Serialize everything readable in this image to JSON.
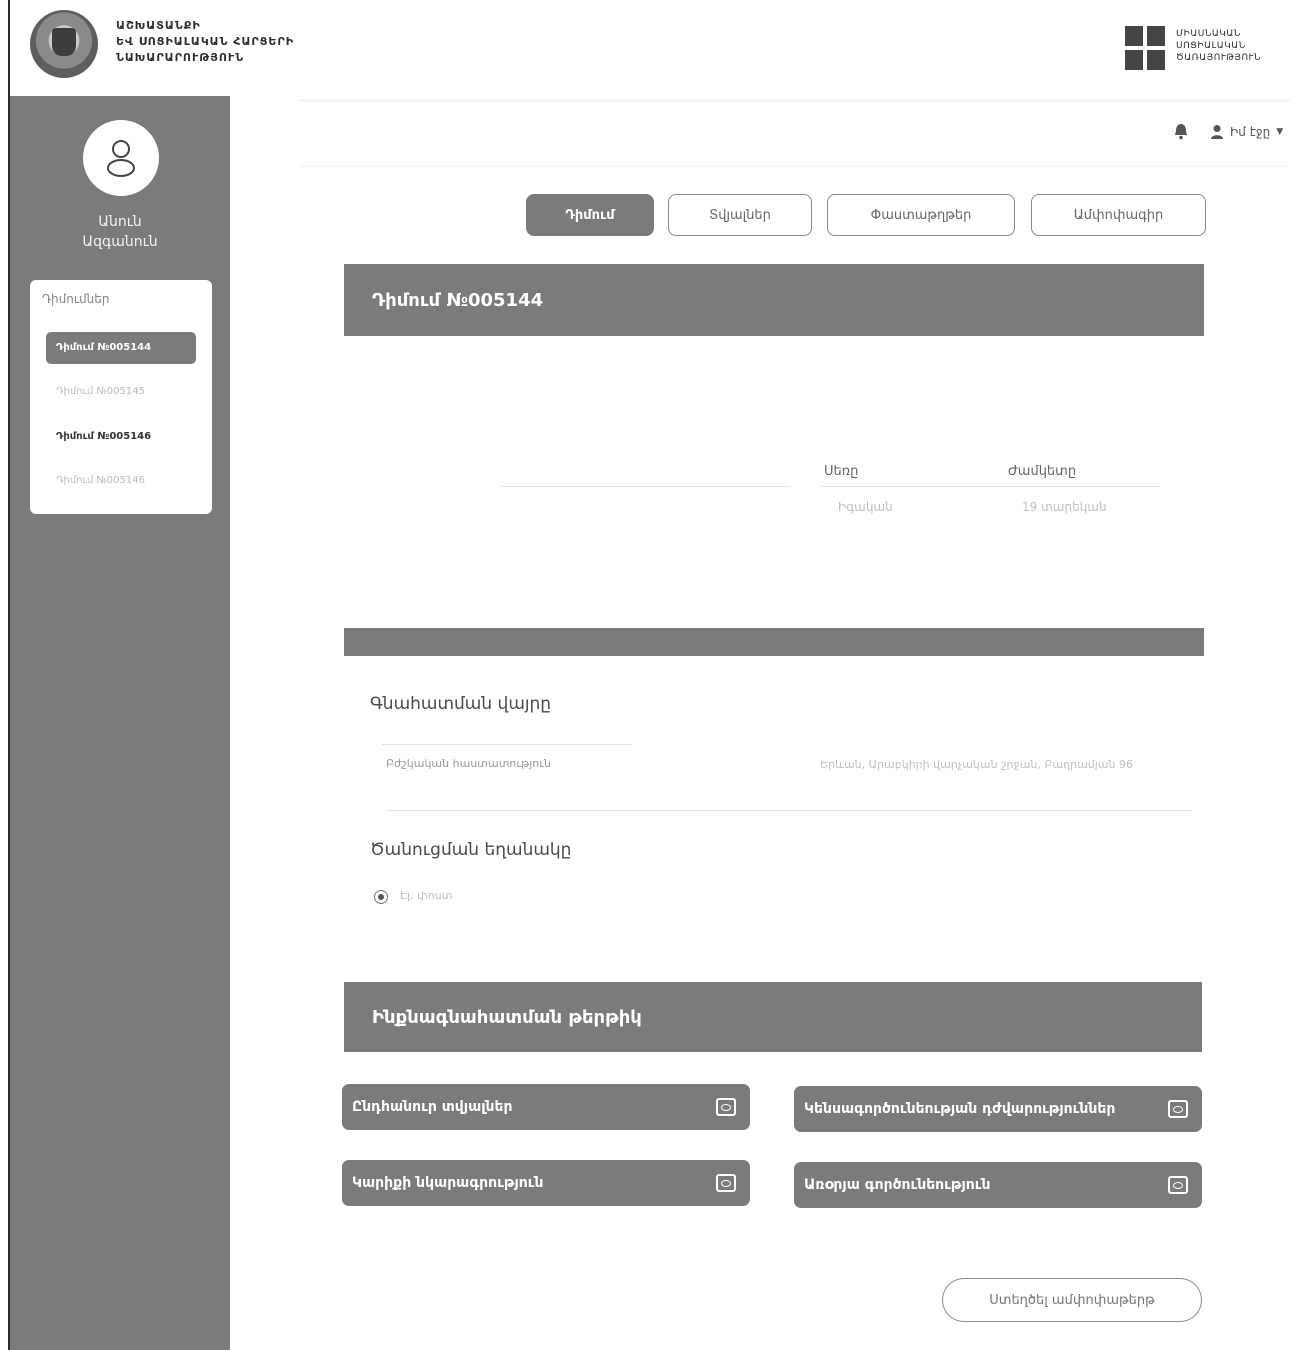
{
  "header": {
    "ministry_lines": [
      "ԱՇԽԱՏԱՆՔԻ",
      "ԵՎ ՍՈՑԻԱԼԱԿԱՆ ՀԱՐՑԵՐԻ",
      "ՆԱԽԱՐԱՐՈՒԹՅՈՒՆ"
    ],
    "agency_lines": [
      "ՄԻԱՍՆԱԿԱՆ",
      "ՍՈՑԻԱԼԱԿԱՆ",
      "ԾԱՌԱՅՈՒԹՅՈՒՆ"
    ]
  },
  "topbar": {
    "user_label": "Իմ էջը"
  },
  "sidebar": {
    "user_first": "Անուն",
    "user_last": "Ազգանուն",
    "applications_title": "Դիմումներ",
    "applications": [
      {
        "label": "Դիմում №005144"
      },
      {
        "label": "Դիմում №005145"
      },
      {
        "label": "Դիմում №005146"
      },
      {
        "label": "Դիմում №005146"
      }
    ]
  },
  "tabs": [
    "Դիմում",
    "Տվյալներ",
    "Փաստաթղթեր",
    "Ամփոփագիր"
  ],
  "application": {
    "title": "Դիմում №005144",
    "col_status": "Սեռը",
    "col_term": "Ժամկետը",
    "status_value": "Իգական",
    "term_value": "19 տարեկան"
  },
  "assessment_place": {
    "title": "Գնահատման վայրը",
    "left_value": "Բժշկական հաստատություն",
    "right_value": "Երևան, Արաբկիրի վարչական շրջան, Բաղրամյան 96"
  },
  "notification": {
    "title": "Ծանուցման եղանակը",
    "option": "Էլ. փոստ"
  },
  "self_assessment": {
    "title": "Ինքնագնահատման թերթիկ",
    "forms": [
      "Ընդհանուր տվյալներ",
      "Կենսագործունեության դժվարություններ",
      "Կարիքի նկարագրություն",
      "Առօրյա գործունեություն"
    ]
  },
  "actions": {
    "submit": "Ստեղծել ամփոփաթերթ"
  }
}
